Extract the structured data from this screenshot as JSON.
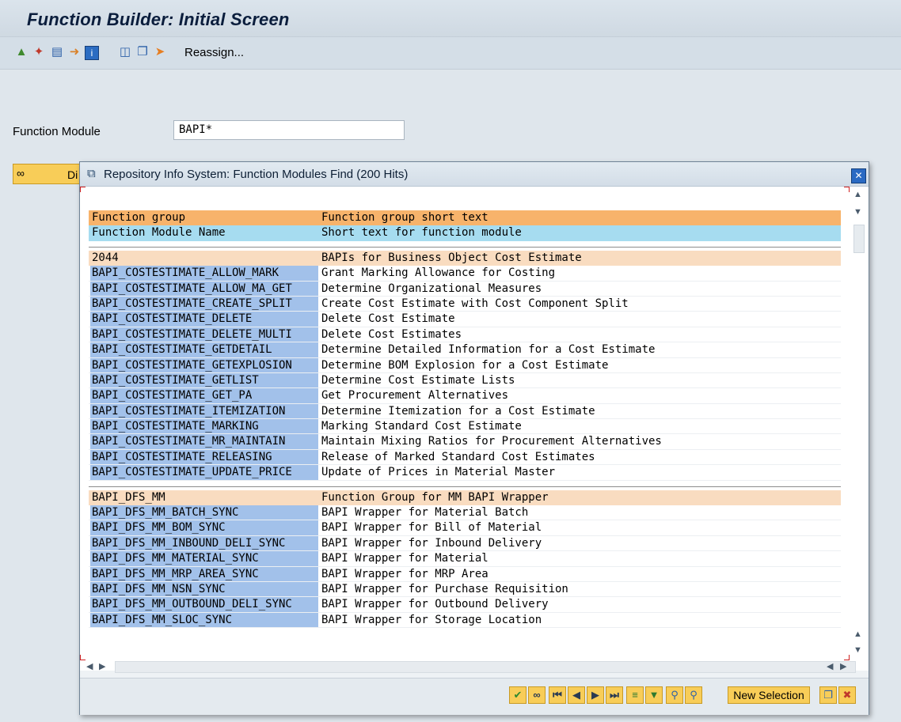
{
  "window": {
    "title": "Function Builder: Initial Screen"
  },
  "toolbar": {
    "icons": [
      "object-list-icon",
      "magic-wand-icon",
      "print-icon",
      "transport-icon",
      "info-icon",
      "delete-icon",
      "copy-icon",
      "rename-icon"
    ],
    "reassign_label": "Reassign..."
  },
  "form": {
    "function_module_label": "Function Module",
    "function_module_value": "BAPI*",
    "display_button_label": "Di"
  },
  "dialog": {
    "title": "Repository Info System: Function Modules Find (200 Hits)",
    "header_rows": [
      {
        "col1": "Function group",
        "col2": "Function group short text"
      },
      {
        "col1": "Function Module Name",
        "col2": "Short text for function module"
      }
    ],
    "groups": [
      {
        "name": "2044",
        "text": "BAPIs for Business Object Cost Estimate",
        "items": [
          {
            "name": "BAPI_COSTESTIMATE_ALLOW_MARK",
            "text": "Grant Marking Allowance for Costing"
          },
          {
            "name": "BAPI_COSTESTIMATE_ALLOW_MA_GET",
            "text": "Determine Organizational Measures"
          },
          {
            "name": "BAPI_COSTESTIMATE_CREATE_SPLIT",
            "text": "Create Cost Estimate with Cost Component Split"
          },
          {
            "name": "BAPI_COSTESTIMATE_DELETE",
            "text": "Delete Cost Estimate"
          },
          {
            "name": "BAPI_COSTESTIMATE_DELETE_MULTI",
            "text": "Delete Cost Estimates"
          },
          {
            "name": "BAPI_COSTESTIMATE_GETDETAIL",
            "text": "Determine Detailed Information for a Cost Estimate"
          },
          {
            "name": "BAPI_COSTESTIMATE_GETEXPLOSION",
            "text": "Determine BOM Explosion for a Cost Estimate"
          },
          {
            "name": "BAPI_COSTESTIMATE_GETLIST",
            "text": "Determine Cost Estimate Lists"
          },
          {
            "name": "BAPI_COSTESTIMATE_GET_PA",
            "text": "Get Procurement Alternatives"
          },
          {
            "name": "BAPI_COSTESTIMATE_ITEMIZATION",
            "text": "Determine Itemization for a Cost Estimate"
          },
          {
            "name": "BAPI_COSTESTIMATE_MARKING",
            "text": "Marking Standard Cost Estimate"
          },
          {
            "name": "BAPI_COSTESTIMATE_MR_MAINTAIN",
            "text": "Maintain Mixing Ratios for Procurement Alternatives"
          },
          {
            "name": "BAPI_COSTESTIMATE_RELEASING",
            "text": "Release of Marked Standard Cost Estimates"
          },
          {
            "name": "BAPI_COSTESTIMATE_UPDATE_PRICE",
            "text": "Update of Prices in Material Master"
          }
        ]
      },
      {
        "name": "BAPI_DFS_MM",
        "text": "Function Group for MM BAPI Wrapper",
        "items": [
          {
            "name": "BAPI_DFS_MM_BATCH_SYNC",
            "text": "BAPI Wrapper for Material Batch"
          },
          {
            "name": "BAPI_DFS_MM_BOM_SYNC",
            "text": "BAPI Wrapper for Bill of Material"
          },
          {
            "name": "BAPI_DFS_MM_INBOUND_DELI_SYNC",
            "text": "BAPI Wrapper for Inbound Delivery"
          },
          {
            "name": "BAPI_DFS_MM_MATERIAL_SYNC",
            "text": "BAPI Wrapper for Material"
          },
          {
            "name": "BAPI_DFS_MM_MRP_AREA_SYNC",
            "text": "BAPI Wrapper for MRP Area"
          },
          {
            "name": "BAPI_DFS_MM_NSN_SYNC",
            "text": "BAPI Wrapper for Purchase Requisition"
          },
          {
            "name": "BAPI_DFS_MM_OUTBOUND_DELI_SYNC",
            "text": "BAPI Wrapper for Outbound Delivery"
          },
          {
            "name": "BAPI_DFS_MM_SLOC_SYNC",
            "text": "BAPI Wrapper for Storage Location"
          }
        ]
      }
    ],
    "footer": {
      "new_selection_label": "New Selection",
      "buttons": [
        "confirm-icon",
        "glasses-icon",
        "first-page-icon",
        "previous-page-icon",
        "next-page-icon",
        "last-page-icon",
        "sort-icon",
        "filter-icon",
        "find-icon",
        "find-next-icon",
        "copy-icon",
        "cancel-icon"
      ]
    }
  },
  "colors": {
    "header1": "#f7b36b",
    "header2": "#a6dcf0",
    "group": "#f9dcc0",
    "item_name": "#a2c1ea",
    "button": "#f8cd58"
  }
}
